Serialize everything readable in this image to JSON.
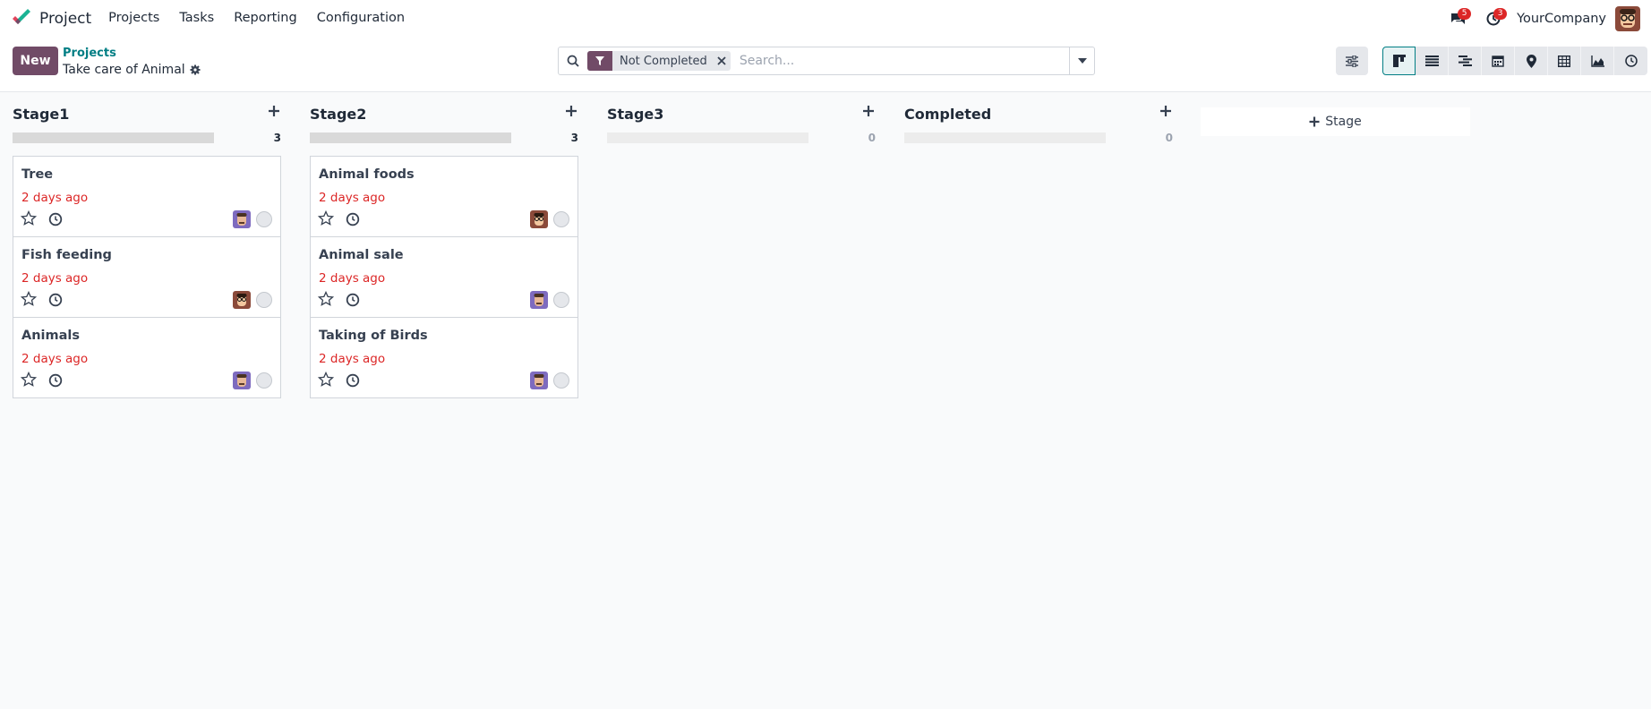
{
  "app": {
    "name": "Project",
    "menu": [
      "Projects",
      "Tasks",
      "Reporting",
      "Configuration"
    ],
    "messages_badge": "5",
    "activities_badge": "3",
    "company": "YourCompany"
  },
  "control": {
    "new_label": "New",
    "breadcrumb_parent": "Projects",
    "breadcrumb_current": "Take care of Animal",
    "facet_label": "Not Completed",
    "search_placeholder": "Search..."
  },
  "stages": [
    {
      "name": "Stage1",
      "count": "3",
      "tasks": [
        {
          "title": "Tree",
          "date": "2 days ago",
          "avatar": "purple"
        },
        {
          "title": "Fish feeding",
          "date": "2 days ago",
          "avatar": "dark"
        },
        {
          "title": "Animals",
          "date": "2 days ago",
          "avatar": "purple"
        }
      ]
    },
    {
      "name": "Stage2",
      "count": "3",
      "tasks": [
        {
          "title": "Animal foods",
          "date": "2 days ago",
          "avatar": "dark"
        },
        {
          "title": "Animal sale",
          "date": "2 days ago",
          "avatar": "purple"
        },
        {
          "title": "Taking of Birds",
          "date": "2 days ago",
          "avatar": "purple"
        }
      ]
    },
    {
      "name": "Stage3",
      "count": "0",
      "tasks": []
    },
    {
      "name": "Completed",
      "count": "0",
      "tasks": []
    }
  ],
  "add_stage_label": "Stage",
  "colors": {
    "brand": "#714b67",
    "accent": "#017e84",
    "overdue": "#dc2626"
  }
}
